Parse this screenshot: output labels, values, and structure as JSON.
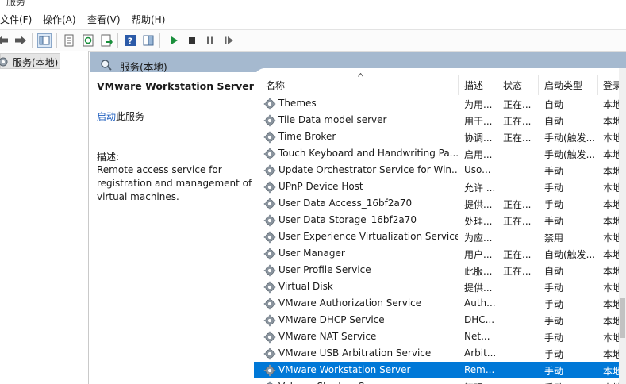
{
  "window": {
    "title": "服务"
  },
  "menu": [
    "文件(F)",
    "操作(A)",
    "查看(V)",
    "帮助(H)"
  ],
  "toolbar": {
    "icons": [
      "back-icon",
      "forward-icon",
      "console-tree-icon",
      "properties-icon",
      "refresh-icon",
      "export-icon",
      "help-icon",
      "show-pane-icon",
      "start-icon",
      "stop-icon",
      "pause-icon",
      "restart-icon"
    ],
    "accent": "#1a8f3c"
  },
  "tree": {
    "root": "服务(本地)"
  },
  "header": {
    "title": "服务(本地)"
  },
  "detail": {
    "service_name": "VMware Workstation Server",
    "start_link": "启动",
    "start_suffix": "此服务",
    "desc_label": "描述:",
    "description": "Remote access service for registration and management of virtual machines."
  },
  "columns": [
    "名称",
    "描述",
    "状态",
    "启动类型",
    "登录"
  ],
  "rows": [
    {
      "name": "Themes",
      "desc": "为用...",
      "status": "正在...",
      "startup": "自动",
      "logon": "本地"
    },
    {
      "name": "Tile Data model server",
      "desc": "用于...",
      "status": "正在...",
      "startup": "自动",
      "logon": "本地"
    },
    {
      "name": "Time Broker",
      "desc": "协调...",
      "status": "正在...",
      "startup": "手动(触发...",
      "logon": "本地"
    },
    {
      "name": "Touch Keyboard and Handwriting Pa...",
      "desc": "启用...",
      "status": "",
      "startup": "手动(触发...",
      "logon": "本地"
    },
    {
      "name": "Update Orchestrator Service for Win...",
      "desc": "Uso...",
      "status": "",
      "startup": "手动",
      "logon": "本地"
    },
    {
      "name": "UPnP Device Host",
      "desc": "允许 ...",
      "status": "",
      "startup": "手动",
      "logon": "本地"
    },
    {
      "name": "User Data Access_16bf2a70",
      "desc": "提供...",
      "status": "正在...",
      "startup": "手动",
      "logon": "本地"
    },
    {
      "name": "User Data Storage_16bf2a70",
      "desc": "处理...",
      "status": "正在...",
      "startup": "手动",
      "logon": "本地"
    },
    {
      "name": "User Experience Virtualization Service",
      "desc": "为应...",
      "status": "",
      "startup": "禁用",
      "logon": "本地"
    },
    {
      "name": "User Manager",
      "desc": "用户...",
      "status": "正在...",
      "startup": "自动(触发...",
      "logon": "本地"
    },
    {
      "name": "User Profile Service",
      "desc": "此服...",
      "status": "正在...",
      "startup": "自动",
      "logon": "本地"
    },
    {
      "name": "Virtual Disk",
      "desc": "提供...",
      "status": "",
      "startup": "手动",
      "logon": "本地"
    },
    {
      "name": "VMware Authorization Service",
      "desc": "Auth...",
      "status": "",
      "startup": "手动",
      "logon": "本地"
    },
    {
      "name": "VMware DHCP Service",
      "desc": "DHC...",
      "status": "",
      "startup": "手动",
      "logon": "本地"
    },
    {
      "name": "VMware NAT Service",
      "desc": "Net...",
      "status": "",
      "startup": "手动",
      "logon": "本地"
    },
    {
      "name": "VMware USB Arbitration Service",
      "desc": "Arbit...",
      "status": "",
      "startup": "手动",
      "logon": "本地"
    },
    {
      "name": "VMware Workstation Server",
      "desc": "Rem...",
      "status": "",
      "startup": "手动",
      "logon": "本地",
      "selected": true
    },
    {
      "name": "Volume Shadow Copy",
      "desc": "管理...",
      "status": "",
      "startup": "手动",
      "logon": "本地"
    }
  ]
}
